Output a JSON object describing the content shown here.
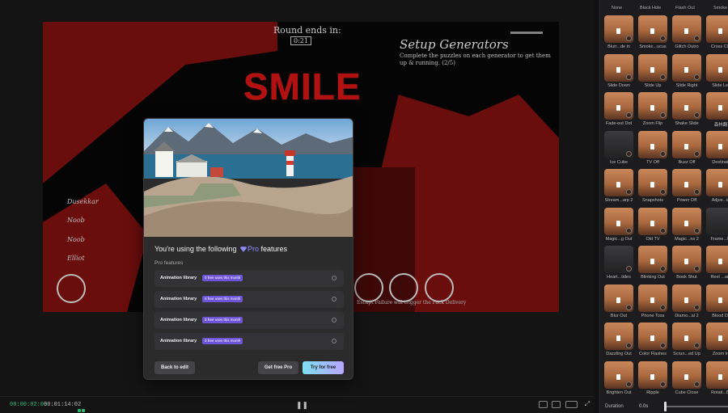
{
  "game": {
    "round_label": "Round ends in:",
    "round_time": "0:21",
    "smile_text": "SMILE",
    "objective_title": "Setup Generators",
    "objective_text": "Complete the puzzles on each generator to get them up & running. (2/5)",
    "players": [
      "Dusekkar",
      "Noob",
      "Noob",
      "Elliot"
    ],
    "caption": "Escapt Failure will trigger the Pack Delivery"
  },
  "timeline": {
    "current_time": "00:00:02:03",
    "total_time": "00:01:14:02",
    "pause_icon": "pause-icon",
    "tools": [
      "fit",
      "ratio",
      "fullscreen"
    ]
  },
  "effects_panel": {
    "top_labels": [
      "None",
      "Black Hole",
      "Flash Out",
      "Smoke"
    ],
    "tiles": [
      [
        "Blurr...de in",
        "Smoke...ucus",
        "Glitch Outro",
        "Cross Clo"
      ],
      [
        "Slide Down",
        "Slide Up",
        "Slide Right",
        "Slide Lef"
      ],
      [
        "Fade-out Dot",
        "Zoom Flip",
        "Shake Slide",
        "森林翻"
      ],
      [
        "Ice Cube",
        "TV Off",
        "Buzz Off",
        "Destinati"
      ],
      [
        "Stream...arp 2",
        "Snapshots",
        "Power Off",
        "Adjus...in"
      ],
      [
        "Magic...g Out",
        "Old TV",
        "Magic...ns 2",
        "Frame...Fl"
      ],
      [
        "Heart...tides",
        "Blinking Out",
        "Book Shut",
        "Reel ...ant"
      ],
      [
        "Blur Out",
        "Phone Toss",
        "Diamo...al 2",
        "Blood Dr"
      ],
      [
        "Dazzling Out",
        "Color Flashes",
        "Scrun...ed Up",
        "Zoom In"
      ],
      [
        "Brighten Out",
        "Ripple",
        "Cube Close",
        "Rotati...Bl"
      ]
    ],
    "duration_label": "Duration",
    "duration_value": "0.0s"
  },
  "modal": {
    "title_prefix": "You're using the following",
    "title_pro": "Pro",
    "title_suffix": "features",
    "section_label": "Pro features",
    "features": [
      {
        "name": "Animation library",
        "badge": "0 free uses this month"
      },
      {
        "name": "Animation library",
        "badge": "0 free uses this month"
      },
      {
        "name": "Animation library",
        "badge": "0 free uses this month"
      },
      {
        "name": "Animation library",
        "badge": "0 free uses this month"
      }
    ],
    "back_button": "Back to edit",
    "get_pro_button": "Get free Pro",
    "try_button": "Try for free",
    "accent_color": "#8f8cff"
  }
}
